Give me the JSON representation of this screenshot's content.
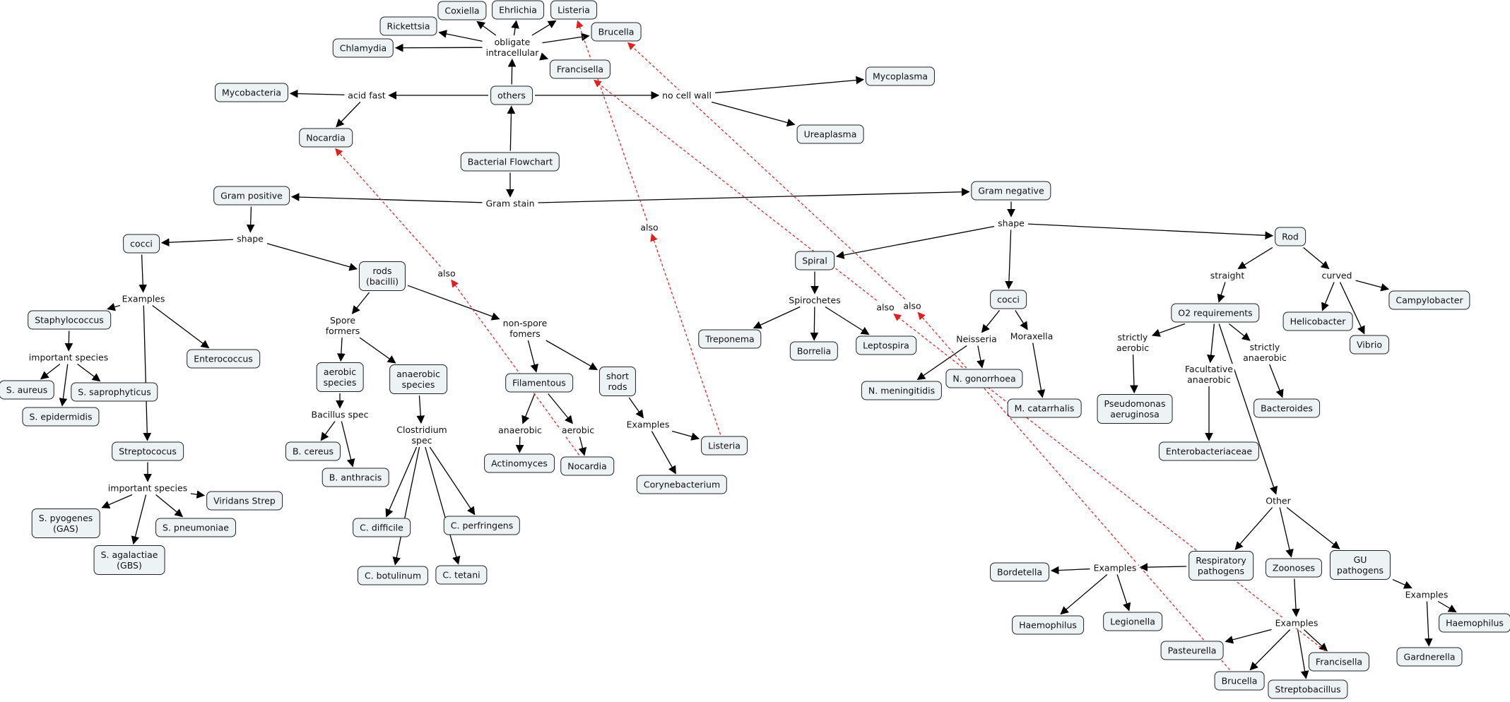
{
  "title": "Bacterial Flowchart",
  "colors": {
    "node_fill": "#edf2f4",
    "node_border": "#222222",
    "edge": "#000000",
    "cross_link": "#e0201e"
  },
  "nodes": [
    {
      "id": "root",
      "text": "Bacterial Flowchart",
      "kind": "concept"
    },
    {
      "id": "others",
      "text": "others",
      "kind": "concept"
    },
    {
      "id": "obligate",
      "text": "obligate\nintracellular",
      "kind": "link"
    },
    {
      "id": "coxiella",
      "text": "Coxiella",
      "kind": "concept"
    },
    {
      "id": "ehrlichia",
      "text": "Ehrlichia",
      "kind": "concept"
    },
    {
      "id": "listeria_top",
      "text": "Listeria",
      "kind": "concept"
    },
    {
      "id": "brucella_top",
      "text": "Brucella",
      "kind": "concept"
    },
    {
      "id": "rickettsia",
      "text": "Rickettsia",
      "kind": "concept"
    },
    {
      "id": "chlamydia",
      "text": "Chlamydia",
      "kind": "concept"
    },
    {
      "id": "francisella_top",
      "text": "Francisella",
      "kind": "concept"
    },
    {
      "id": "acidfast",
      "text": "acid fast",
      "kind": "link"
    },
    {
      "id": "mycobacteria",
      "text": "Mycobacteria",
      "kind": "concept"
    },
    {
      "id": "nocardia_top",
      "text": "Nocardia",
      "kind": "concept"
    },
    {
      "id": "nocellwall",
      "text": "no cell wall",
      "kind": "link"
    },
    {
      "id": "mycoplasma",
      "text": "Mycoplasma",
      "kind": "concept"
    },
    {
      "id": "ureaplasma",
      "text": "Ureaplasma",
      "kind": "concept"
    },
    {
      "id": "gramstain",
      "text": "Gram stain",
      "kind": "link"
    },
    {
      "id": "grampos",
      "text": "Gram positive",
      "kind": "concept"
    },
    {
      "id": "gramneg",
      "text": "Gram negative",
      "kind": "concept"
    },
    {
      "id": "shape_l",
      "text": "shape",
      "kind": "link"
    },
    {
      "id": "cocci_l",
      "text": "cocci",
      "kind": "concept"
    },
    {
      "id": "rods",
      "text": "rods\n(bacilli)",
      "kind": "concept"
    },
    {
      "id": "examples_l",
      "text": "Examples",
      "kind": "link"
    },
    {
      "id": "staph",
      "text": "Staphylococcus",
      "kind": "concept"
    },
    {
      "id": "entero",
      "text": "Enterococcus",
      "kind": "concept"
    },
    {
      "id": "impsp1",
      "text": "important species",
      "kind": "link"
    },
    {
      "id": "saureus",
      "text": "S. aureus",
      "kind": "concept"
    },
    {
      "id": "sepi",
      "text": "S. epidermidis",
      "kind": "concept"
    },
    {
      "id": "ssapro",
      "text": "S. saprophyticus",
      "kind": "concept"
    },
    {
      "id": "strep",
      "text": "Streptococus",
      "kind": "concept"
    },
    {
      "id": "impsp2",
      "text": "important species",
      "kind": "link"
    },
    {
      "id": "viridans",
      "text": "Viridans Strep",
      "kind": "concept"
    },
    {
      "id": "spyo",
      "text": "S. pyogenes\n(GAS)",
      "kind": "concept"
    },
    {
      "id": "spneu",
      "text": "S. pneumoniae",
      "kind": "concept"
    },
    {
      "id": "sagal",
      "text": "S. agalactiae\n(GBS)",
      "kind": "concept"
    },
    {
      "id": "spore",
      "text": "Spore\nformers",
      "kind": "link"
    },
    {
      "id": "aerobicsp",
      "text": "aerobic\nspecies",
      "kind": "concept"
    },
    {
      "id": "anaerobicsp",
      "text": "anaerobic\nspecies",
      "kind": "concept"
    },
    {
      "id": "bacillus",
      "text": "Bacillus spec",
      "kind": "link"
    },
    {
      "id": "bcereus",
      "text": "B. cereus",
      "kind": "concept"
    },
    {
      "id": "banthracis",
      "text": "B. anthracis",
      "kind": "concept"
    },
    {
      "id": "clostridium",
      "text": "Clostridium\nspec",
      "kind": "link"
    },
    {
      "id": "cdiff",
      "text": "C. difficile",
      "kind": "concept"
    },
    {
      "id": "cperf",
      "text": "C. perfringens",
      "kind": "concept"
    },
    {
      "id": "cbot",
      "text": "C. botulinum",
      "kind": "concept"
    },
    {
      "id": "ctet",
      "text": "C. tetani",
      "kind": "concept"
    },
    {
      "id": "nonspore",
      "text": "non-spore\nfomers",
      "kind": "link"
    },
    {
      "id": "filament",
      "text": "Filamentous",
      "kind": "concept"
    },
    {
      "id": "shortrods",
      "text": "short\nrods",
      "kind": "concept"
    },
    {
      "id": "anaerobic_f",
      "text": "anaerobic",
      "kind": "link"
    },
    {
      "id": "aerobic_f",
      "text": "aerobic",
      "kind": "link"
    },
    {
      "id": "actino",
      "text": "Actinomyces",
      "kind": "concept"
    },
    {
      "id": "nocardia_bot",
      "text": "Nocardia",
      "kind": "concept"
    },
    {
      "id": "examples_m",
      "text": "Examples",
      "kind": "link"
    },
    {
      "id": "listeria_bot",
      "text": "Listeria",
      "kind": "concept"
    },
    {
      "id": "coryne",
      "text": "Corynebacterium",
      "kind": "concept"
    },
    {
      "id": "also1",
      "text": "also",
      "kind": "link"
    },
    {
      "id": "also2",
      "text": "also",
      "kind": "link"
    },
    {
      "id": "spiral",
      "text": "Spiral",
      "kind": "concept"
    },
    {
      "id": "spiro",
      "text": "Spirochetes",
      "kind": "link"
    },
    {
      "id": "trepo",
      "text": "Treponema",
      "kind": "concept"
    },
    {
      "id": "borrelia",
      "text": "Borrelia",
      "kind": "concept"
    },
    {
      "id": "lepto",
      "text": "Leptospira",
      "kind": "concept"
    },
    {
      "id": "also3",
      "text": "also",
      "kind": "link"
    },
    {
      "id": "also4",
      "text": "also",
      "kind": "link"
    },
    {
      "id": "shape_r",
      "text": "shape",
      "kind": "link"
    },
    {
      "id": "cocci_r",
      "text": "cocci",
      "kind": "concept"
    },
    {
      "id": "neisseria",
      "text": "Neisseria",
      "kind": "link"
    },
    {
      "id": "moraxella",
      "text": "Moraxella",
      "kind": "link"
    },
    {
      "id": "nmen",
      "text": "N. meningitidis",
      "kind": "concept"
    },
    {
      "id": "ngon",
      "text": "N. gonorrhoea",
      "kind": "concept"
    },
    {
      "id": "mcat",
      "text": "M. catarrhalis",
      "kind": "concept"
    },
    {
      "id": "rod",
      "text": "Rod",
      "kind": "concept"
    },
    {
      "id": "straight",
      "text": "straight",
      "kind": "link"
    },
    {
      "id": "curved",
      "text": "curved",
      "kind": "link"
    },
    {
      "id": "o2",
      "text": "O2 requirements",
      "kind": "concept"
    },
    {
      "id": "helico",
      "text": "Helicobacter",
      "kind": "concept"
    },
    {
      "id": "vibrio",
      "text": "Vibrio",
      "kind": "concept"
    },
    {
      "id": "campy",
      "text": "Campylobacter",
      "kind": "concept"
    },
    {
      "id": "strictaer",
      "text": "strictly\naerobic",
      "kind": "link"
    },
    {
      "id": "facult",
      "text": "Facultative\nanaerobic",
      "kind": "link"
    },
    {
      "id": "strictana",
      "text": "strictly\nanaerobic",
      "kind": "link"
    },
    {
      "id": "pseudo",
      "text": "Pseudomonas\naeruginosa",
      "kind": "concept"
    },
    {
      "id": "enterobac",
      "text": "Enterobacteriaceae",
      "kind": "concept"
    },
    {
      "id": "bactero",
      "text": "Bacteroides",
      "kind": "concept"
    },
    {
      "id": "other",
      "text": "Other",
      "kind": "link"
    },
    {
      "id": "resp",
      "text": "Respiratory\npathogens",
      "kind": "concept"
    },
    {
      "id": "zoon",
      "text": "Zoonoses",
      "kind": "concept"
    },
    {
      "id": "gu",
      "text": "GU\npathogens",
      "kind": "concept"
    },
    {
      "id": "examples_r1",
      "text": "Examples",
      "kind": "link"
    },
    {
      "id": "bordetella",
      "text": "Bordetella",
      "kind": "concept"
    },
    {
      "id": "haemo1",
      "text": "Haemophilus",
      "kind": "concept"
    },
    {
      "id": "legion",
      "text": "Legionella",
      "kind": "concept"
    },
    {
      "id": "examples_r2",
      "text": "Examples",
      "kind": "link"
    },
    {
      "id": "pasteur",
      "text": "Pasteurella",
      "kind": "concept"
    },
    {
      "id": "brucella_bot",
      "text": "Brucella",
      "kind": "concept"
    },
    {
      "id": "streptobac",
      "text": "Streptobacillus",
      "kind": "concept"
    },
    {
      "id": "francisella_bot",
      "text": "Francisella",
      "kind": "concept"
    },
    {
      "id": "examples_r3",
      "text": "Examples",
      "kind": "link"
    },
    {
      "id": "haemo2",
      "text": "Haemophilus",
      "kind": "concept"
    },
    {
      "id": "gardner",
      "text": "Gardnerella",
      "kind": "concept"
    }
  ],
  "edges": [
    [
      "root",
      "others"
    ],
    [
      "others",
      "obligate"
    ],
    [
      "obligate",
      "coxiella"
    ],
    [
      "obligate",
      "ehrlichia"
    ],
    [
      "obligate",
      "listeria_top"
    ],
    [
      "obligate",
      "brucella_top"
    ],
    [
      "obligate",
      "rickettsia"
    ],
    [
      "obligate",
      "chlamydia"
    ],
    [
      "obligate",
      "francisella_top"
    ],
    [
      "others",
      "acidfast"
    ],
    [
      "acidfast",
      "mycobacteria"
    ],
    [
      "acidfast",
      "nocardia_top"
    ],
    [
      "others",
      "nocellwall"
    ],
    [
      "nocellwall",
      "mycoplasma"
    ],
    [
      "nocellwall",
      "ureaplasma"
    ],
    [
      "root",
      "gramstain"
    ],
    [
      "gramstain",
      "grampos"
    ],
    [
      "gramstain",
      "gramneg"
    ],
    [
      "grampos",
      "shape_l"
    ],
    [
      "shape_l",
      "cocci_l"
    ],
    [
      "shape_l",
      "rods"
    ],
    [
      "cocci_l",
      "examples_l"
    ],
    [
      "examples_l",
      "staph"
    ],
    [
      "examples_l",
      "entero"
    ],
    [
      "examples_l",
      "strep"
    ],
    [
      "staph",
      "impsp1"
    ],
    [
      "impsp1",
      "saureus"
    ],
    [
      "impsp1",
      "sepi"
    ],
    [
      "impsp1",
      "ssapro"
    ],
    [
      "strep",
      "impsp2"
    ],
    [
      "impsp2",
      "viridans"
    ],
    [
      "impsp2",
      "spyo"
    ],
    [
      "impsp2",
      "spneu"
    ],
    [
      "impsp2",
      "sagal"
    ],
    [
      "rods",
      "spore"
    ],
    [
      "spore",
      "aerobicsp"
    ],
    [
      "spore",
      "anaerobicsp"
    ],
    [
      "aerobicsp",
      "bacillus"
    ],
    [
      "bacillus",
      "bcereus"
    ],
    [
      "bacillus",
      "banthracis"
    ],
    [
      "anaerobicsp",
      "clostridium"
    ],
    [
      "clostridium",
      "cdiff"
    ],
    [
      "clostridium",
      "cperf"
    ],
    [
      "clostridium",
      "cbot"
    ],
    [
      "clostridium",
      "ctet"
    ],
    [
      "rods",
      "nonspore"
    ],
    [
      "nonspore",
      "filament"
    ],
    [
      "nonspore",
      "shortrods"
    ],
    [
      "filament",
      "anaerobic_f"
    ],
    [
      "filament",
      "aerobic_f"
    ],
    [
      "anaerobic_f",
      "actino"
    ],
    [
      "aerobic_f",
      "nocardia_bot"
    ],
    [
      "shortrods",
      "examples_m"
    ],
    [
      "examples_m",
      "listeria_bot"
    ],
    [
      "examples_m",
      "coryne"
    ],
    [
      "gramneg",
      "shape_r"
    ],
    [
      "shape_r",
      "spiral"
    ],
    [
      "shape_r",
      "cocci_r"
    ],
    [
      "shape_r",
      "rod"
    ],
    [
      "spiral",
      "spiro"
    ],
    [
      "spiro",
      "trepo"
    ],
    [
      "spiro",
      "borrelia"
    ],
    [
      "spiro",
      "lepto"
    ],
    [
      "cocci_r",
      "neisseria"
    ],
    [
      "cocci_r",
      "moraxella"
    ],
    [
      "neisseria",
      "nmen"
    ],
    [
      "neisseria",
      "ngon"
    ],
    [
      "moraxella",
      "mcat"
    ],
    [
      "rod",
      "straight"
    ],
    [
      "rod",
      "curved"
    ],
    [
      "straight",
      "o2"
    ],
    [
      "curved",
      "helico"
    ],
    [
      "curved",
      "vibrio"
    ],
    [
      "curved",
      "campy"
    ],
    [
      "o2",
      "strictaer"
    ],
    [
      "o2",
      "facult"
    ],
    [
      "o2",
      "strictana"
    ],
    [
      "o2",
      "other"
    ],
    [
      "strictaer",
      "pseudo"
    ],
    [
      "facult",
      "enterobac"
    ],
    [
      "strictana",
      "bactero"
    ],
    [
      "other",
      "resp"
    ],
    [
      "other",
      "zoon"
    ],
    [
      "other",
      "gu"
    ],
    [
      "resp",
      "examples_r1"
    ],
    [
      "examples_r1",
      "bordetella"
    ],
    [
      "examples_r1",
      "haemo1"
    ],
    [
      "examples_r1",
      "legion"
    ],
    [
      "zoon",
      "examples_r2"
    ],
    [
      "examples_r2",
      "pasteur"
    ],
    [
      "examples_r2",
      "brucella_bot"
    ],
    [
      "examples_r2",
      "streptobac"
    ],
    [
      "examples_r2",
      "francisella_bot"
    ],
    [
      "gu",
      "examples_r3"
    ],
    [
      "examples_r3",
      "haemo2"
    ],
    [
      "examples_r3",
      "gardner"
    ]
  ],
  "cross_links": [
    [
      "nocardia_bot",
      "also1",
      "nocardia_top"
    ],
    [
      "listeria_bot",
      "also2",
      "listeria_top"
    ],
    [
      "francisella_bot",
      "also3",
      "francisella_top"
    ],
    [
      "brucella_bot",
      "also4",
      "brucella_top"
    ]
  ]
}
